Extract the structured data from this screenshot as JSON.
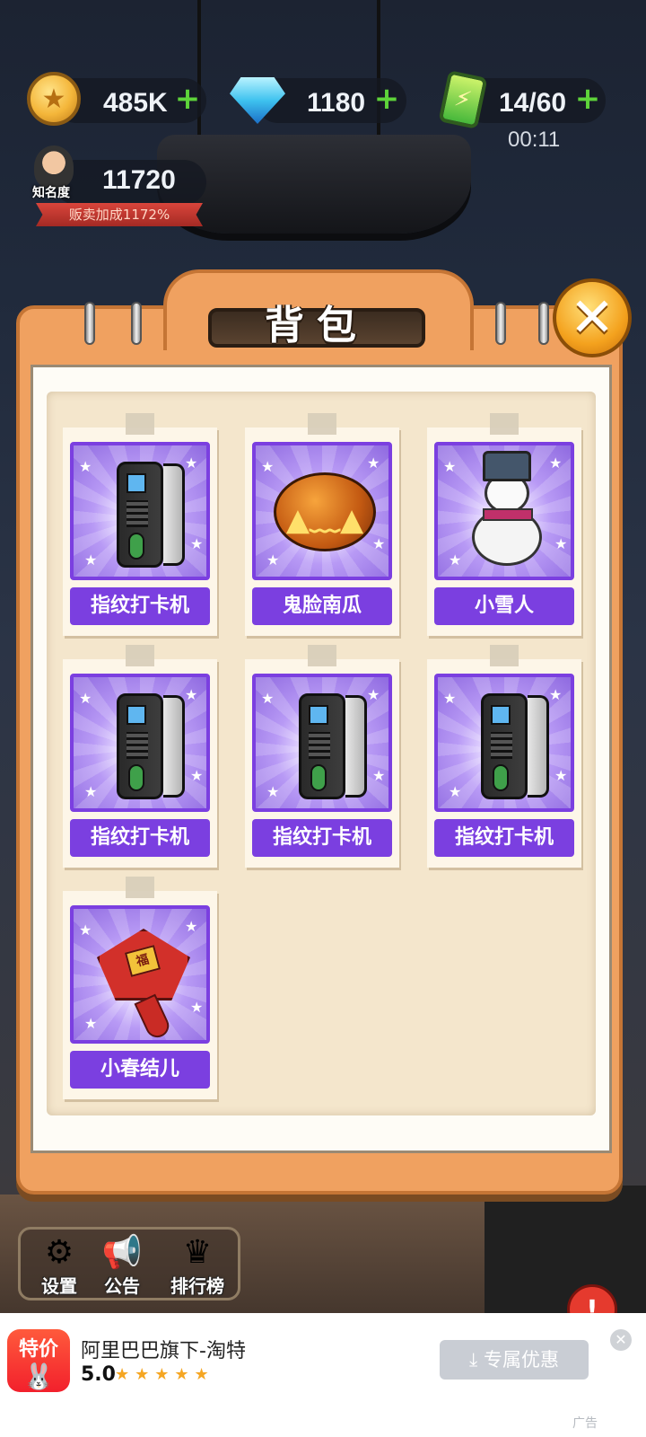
{
  "resources": {
    "coins": "485K",
    "gems": "1180",
    "energy": "14/60",
    "energy_timer": "00:11",
    "fame_label": "知名度",
    "fame_value": "11720",
    "sell_bonus": "贩卖加成1172%"
  },
  "panel": {
    "title": "背包",
    "items": [
      {
        "label": "指纹打卡机",
        "icon": "fingerprint-machine-icon"
      },
      {
        "label": "鬼脸南瓜",
        "icon": "pumpkin-icon"
      },
      {
        "label": "小雪人",
        "icon": "snowman-icon"
      },
      {
        "label": "指纹打卡机",
        "icon": "fingerprint-machine-icon"
      },
      {
        "label": "指纹打卡机",
        "icon": "fingerprint-machine-icon"
      },
      {
        "label": "指纹打卡机",
        "icon": "fingerprint-machine-icon"
      },
      {
        "label": "小春结儿",
        "icon": "chinese-knot-icon"
      }
    ]
  },
  "menu": {
    "settings": "设置",
    "notice": "公告",
    "ranking": "排行榜"
  },
  "ad": {
    "logo_text": "特价",
    "title": "阿里巴巴旗下-淘特",
    "rating": "5.0",
    "cta": "专属优惠",
    "tag": "广告"
  },
  "colors": {
    "panel_orange": "#f0a160",
    "card_purple": "#7b3fe0",
    "plus_green": "#5ed33a"
  }
}
